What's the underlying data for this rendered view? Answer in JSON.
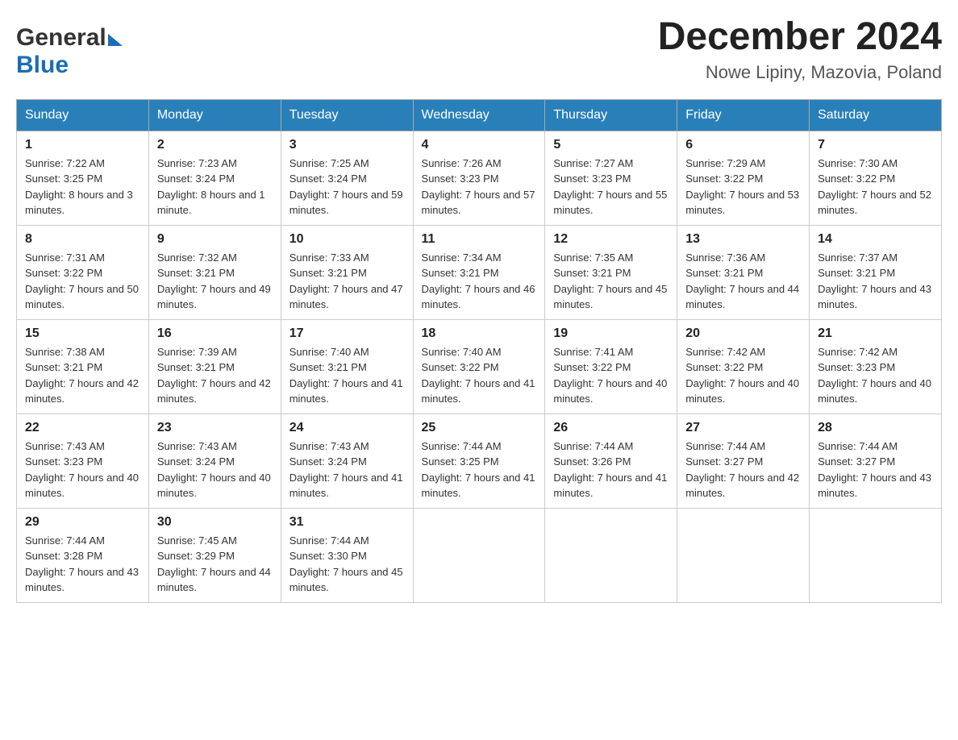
{
  "logo": {
    "general": "General",
    "blue": "Blue"
  },
  "header": {
    "month_year": "December 2024",
    "location": "Nowe Lipiny, Mazovia, Poland"
  },
  "weekdays": [
    "Sunday",
    "Monday",
    "Tuesday",
    "Wednesday",
    "Thursday",
    "Friday",
    "Saturday"
  ],
  "weeks": [
    [
      {
        "day": "1",
        "sunrise": "Sunrise: 7:22 AM",
        "sunset": "Sunset: 3:25 PM",
        "daylight": "Daylight: 8 hours and 3 minutes."
      },
      {
        "day": "2",
        "sunrise": "Sunrise: 7:23 AM",
        "sunset": "Sunset: 3:24 PM",
        "daylight": "Daylight: 8 hours and 1 minute."
      },
      {
        "day": "3",
        "sunrise": "Sunrise: 7:25 AM",
        "sunset": "Sunset: 3:24 PM",
        "daylight": "Daylight: 7 hours and 59 minutes."
      },
      {
        "day": "4",
        "sunrise": "Sunrise: 7:26 AM",
        "sunset": "Sunset: 3:23 PM",
        "daylight": "Daylight: 7 hours and 57 minutes."
      },
      {
        "day": "5",
        "sunrise": "Sunrise: 7:27 AM",
        "sunset": "Sunset: 3:23 PM",
        "daylight": "Daylight: 7 hours and 55 minutes."
      },
      {
        "day": "6",
        "sunrise": "Sunrise: 7:29 AM",
        "sunset": "Sunset: 3:22 PM",
        "daylight": "Daylight: 7 hours and 53 minutes."
      },
      {
        "day": "7",
        "sunrise": "Sunrise: 7:30 AM",
        "sunset": "Sunset: 3:22 PM",
        "daylight": "Daylight: 7 hours and 52 minutes."
      }
    ],
    [
      {
        "day": "8",
        "sunrise": "Sunrise: 7:31 AM",
        "sunset": "Sunset: 3:22 PM",
        "daylight": "Daylight: 7 hours and 50 minutes."
      },
      {
        "day": "9",
        "sunrise": "Sunrise: 7:32 AM",
        "sunset": "Sunset: 3:21 PM",
        "daylight": "Daylight: 7 hours and 49 minutes."
      },
      {
        "day": "10",
        "sunrise": "Sunrise: 7:33 AM",
        "sunset": "Sunset: 3:21 PM",
        "daylight": "Daylight: 7 hours and 47 minutes."
      },
      {
        "day": "11",
        "sunrise": "Sunrise: 7:34 AM",
        "sunset": "Sunset: 3:21 PM",
        "daylight": "Daylight: 7 hours and 46 minutes."
      },
      {
        "day": "12",
        "sunrise": "Sunrise: 7:35 AM",
        "sunset": "Sunset: 3:21 PM",
        "daylight": "Daylight: 7 hours and 45 minutes."
      },
      {
        "day": "13",
        "sunrise": "Sunrise: 7:36 AM",
        "sunset": "Sunset: 3:21 PM",
        "daylight": "Daylight: 7 hours and 44 minutes."
      },
      {
        "day": "14",
        "sunrise": "Sunrise: 7:37 AM",
        "sunset": "Sunset: 3:21 PM",
        "daylight": "Daylight: 7 hours and 43 minutes."
      }
    ],
    [
      {
        "day": "15",
        "sunrise": "Sunrise: 7:38 AM",
        "sunset": "Sunset: 3:21 PM",
        "daylight": "Daylight: 7 hours and 42 minutes."
      },
      {
        "day": "16",
        "sunrise": "Sunrise: 7:39 AM",
        "sunset": "Sunset: 3:21 PM",
        "daylight": "Daylight: 7 hours and 42 minutes."
      },
      {
        "day": "17",
        "sunrise": "Sunrise: 7:40 AM",
        "sunset": "Sunset: 3:21 PM",
        "daylight": "Daylight: 7 hours and 41 minutes."
      },
      {
        "day": "18",
        "sunrise": "Sunrise: 7:40 AM",
        "sunset": "Sunset: 3:22 PM",
        "daylight": "Daylight: 7 hours and 41 minutes."
      },
      {
        "day": "19",
        "sunrise": "Sunrise: 7:41 AM",
        "sunset": "Sunset: 3:22 PM",
        "daylight": "Daylight: 7 hours and 40 minutes."
      },
      {
        "day": "20",
        "sunrise": "Sunrise: 7:42 AM",
        "sunset": "Sunset: 3:22 PM",
        "daylight": "Daylight: 7 hours and 40 minutes."
      },
      {
        "day": "21",
        "sunrise": "Sunrise: 7:42 AM",
        "sunset": "Sunset: 3:23 PM",
        "daylight": "Daylight: 7 hours and 40 minutes."
      }
    ],
    [
      {
        "day": "22",
        "sunrise": "Sunrise: 7:43 AM",
        "sunset": "Sunset: 3:23 PM",
        "daylight": "Daylight: 7 hours and 40 minutes."
      },
      {
        "day": "23",
        "sunrise": "Sunrise: 7:43 AM",
        "sunset": "Sunset: 3:24 PM",
        "daylight": "Daylight: 7 hours and 40 minutes."
      },
      {
        "day": "24",
        "sunrise": "Sunrise: 7:43 AM",
        "sunset": "Sunset: 3:24 PM",
        "daylight": "Daylight: 7 hours and 41 minutes."
      },
      {
        "day": "25",
        "sunrise": "Sunrise: 7:44 AM",
        "sunset": "Sunset: 3:25 PM",
        "daylight": "Daylight: 7 hours and 41 minutes."
      },
      {
        "day": "26",
        "sunrise": "Sunrise: 7:44 AM",
        "sunset": "Sunset: 3:26 PM",
        "daylight": "Daylight: 7 hours and 41 minutes."
      },
      {
        "day": "27",
        "sunrise": "Sunrise: 7:44 AM",
        "sunset": "Sunset: 3:27 PM",
        "daylight": "Daylight: 7 hours and 42 minutes."
      },
      {
        "day": "28",
        "sunrise": "Sunrise: 7:44 AM",
        "sunset": "Sunset: 3:27 PM",
        "daylight": "Daylight: 7 hours and 43 minutes."
      }
    ],
    [
      {
        "day": "29",
        "sunrise": "Sunrise: 7:44 AM",
        "sunset": "Sunset: 3:28 PM",
        "daylight": "Daylight: 7 hours and 43 minutes."
      },
      {
        "day": "30",
        "sunrise": "Sunrise: 7:45 AM",
        "sunset": "Sunset: 3:29 PM",
        "daylight": "Daylight: 7 hours and 44 minutes."
      },
      {
        "day": "31",
        "sunrise": "Sunrise: 7:44 AM",
        "sunset": "Sunset: 3:30 PM",
        "daylight": "Daylight: 7 hours and 45 minutes."
      },
      null,
      null,
      null,
      null
    ]
  ]
}
